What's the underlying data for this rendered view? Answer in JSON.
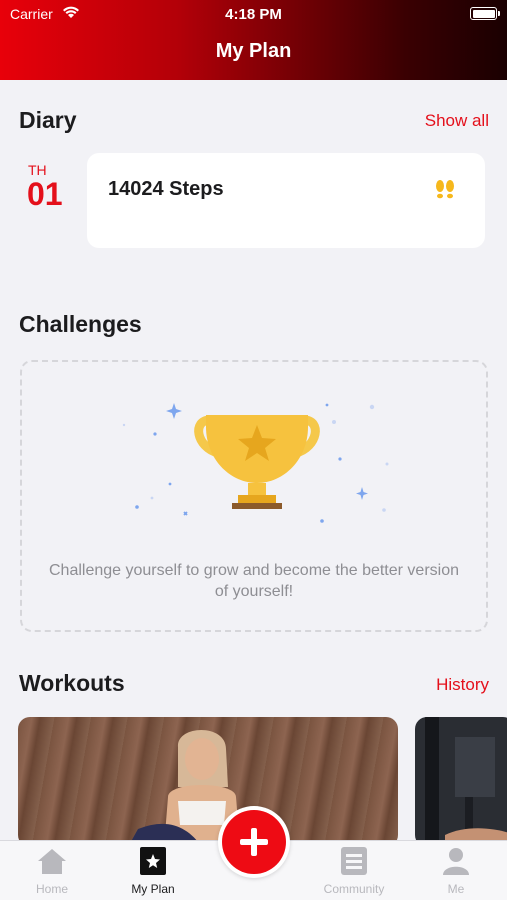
{
  "status": {
    "carrier": "Carrier",
    "time": "4:18 PM"
  },
  "header": {
    "title": "My Plan"
  },
  "diary": {
    "title": "Diary",
    "show_all": "Show all",
    "date_dow": "TH",
    "date_day": "01",
    "steps": "14024 Steps"
  },
  "challenges": {
    "title": "Challenges",
    "empty_text": "Challenge yourself to grow and become the better version of yourself!"
  },
  "workouts": {
    "title": "Workouts",
    "history": "History"
  },
  "tabs": [
    {
      "label": "Home",
      "icon": "house-icon"
    },
    {
      "label": "My Plan",
      "icon": "star-icon"
    },
    {
      "label": "Community",
      "icon": "document-icon"
    },
    {
      "label": "Me",
      "icon": "person-icon"
    }
  ],
  "colors": {
    "accent": "#e4101b",
    "header_start": "#e8000a",
    "header_end": "#1a0001"
  }
}
